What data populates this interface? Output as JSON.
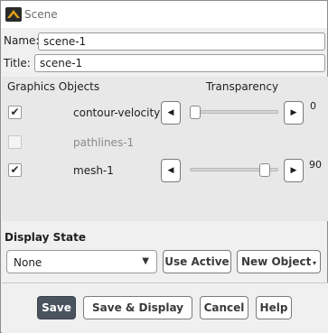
{
  "window": {
    "title": "Scene"
  },
  "name_field": {
    "label": "Name:",
    "value": "scene-1"
  },
  "title_field": {
    "label": "Title:",
    "value": "scene-1"
  },
  "graphics_objects": {
    "header": "Graphics Objects",
    "transparency_header": "Transparency",
    "items": [
      {
        "label": "contour-velocity",
        "checked": true,
        "enabled": true,
        "transparency": 0,
        "transparency_text": "0"
      },
      {
        "label": "pathlines-1",
        "checked": false,
        "enabled": false
      },
      {
        "label": "mesh-1",
        "checked": true,
        "enabled": true,
        "transparency": 90,
        "transparency_text": "90"
      }
    ],
    "check_glyph": "✔",
    "left_arrow": "◀",
    "right_arrow": "▶"
  },
  "display_state": {
    "title": "Display State",
    "selected": "None",
    "caret": "▼",
    "use_active_label": "Use Active",
    "new_object_label": "New Object",
    "new_object_caret": "▾"
  },
  "footer": {
    "save_label": "Save",
    "save_display_label": "Save & Display",
    "cancel_label": "Cancel",
    "help_label": "Help"
  },
  "colors": {
    "primary_button": "#4a545f",
    "background": "#f0f0f0",
    "group_background": "#e8e8e8"
  }
}
